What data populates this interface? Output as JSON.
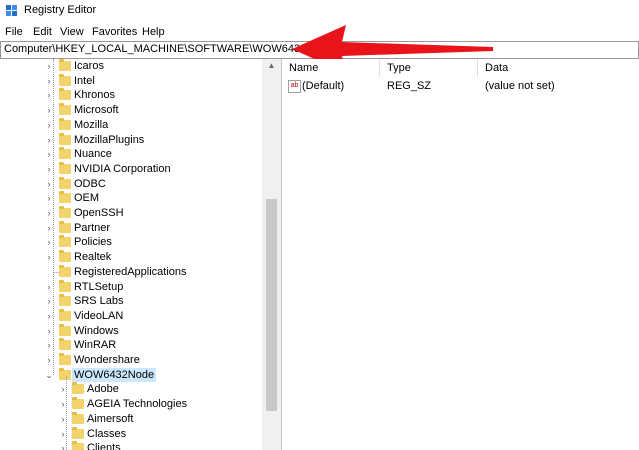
{
  "window": {
    "title": "Registry Editor"
  },
  "menu": [
    "File",
    "Edit",
    "View",
    "Favorites",
    "Help"
  ],
  "address": "Computer\\HKEY_LOCAL_MACHINE\\SOFTWARE\\WOW6432Node",
  "colors": {
    "arrow": "#e8141a",
    "folder": "#f3d36b",
    "selection": "#cce8ff"
  },
  "tree": {
    "items": [
      "Icaros",
      "Intel",
      "Khronos",
      "Microsoft",
      "Mozilla",
      "MozillaPlugins",
      "Nuance",
      "NVIDIA Corporation",
      "ODBC",
      "OEM",
      "OpenSSH",
      "Partner",
      "Policies",
      "Realtek",
      "RegisteredApplications",
      "RTLSetup",
      "SRS Labs",
      "VideoLAN",
      "Windows",
      "WinRAR",
      "Wondershare",
      "WOW6432Node"
    ],
    "children": [
      "Adobe",
      "AGEIA Technologies",
      "Aimersoft",
      "Classes",
      "Clients"
    ]
  },
  "list": {
    "headers": {
      "name": "Name",
      "type": "Type",
      "data": "Data"
    },
    "rows": [
      {
        "name": "(Default)",
        "type": "REG_SZ",
        "data": "(value not set)"
      }
    ]
  }
}
